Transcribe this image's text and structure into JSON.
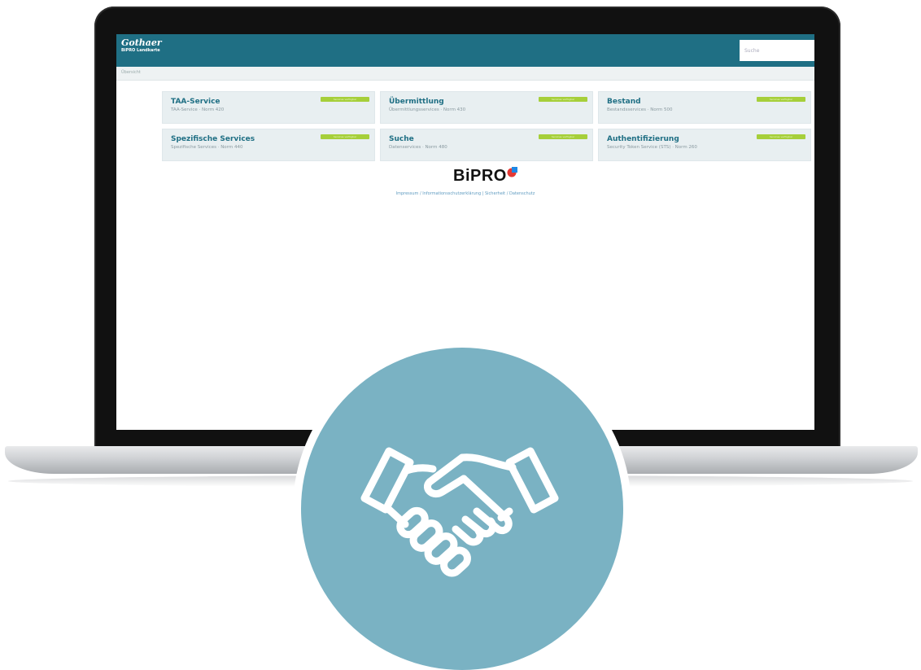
{
  "app": {
    "logo_title": "Gothaer",
    "logo_subtitle": "BiPRO Landkarte",
    "search_placeholder": "Suche",
    "breadcrumb": "Übersicht"
  },
  "cards": [
    {
      "title": "TAA-Service",
      "subtitle": "TAA-Service · Norm 420",
      "badge": "Services verfügbar"
    },
    {
      "title": "Übermittlung",
      "subtitle": "Übermittlungsservices · Norm 430",
      "badge": "Services verfügbar"
    },
    {
      "title": "Bestand",
      "subtitle": "Bestandsservices · Norm 500",
      "badge": "Services verfügbar"
    },
    {
      "title": "Spezifische Services",
      "subtitle": "Spezifische Services · Norm 440",
      "badge": "Services verfügbar"
    },
    {
      "title": "Suche",
      "subtitle": "Datenservices · Norm 480",
      "badge": "Services verfügbar"
    },
    {
      "title": "Authentifizierung",
      "subtitle": "Security Token Service (STS) · Norm 260",
      "badge": "Services verfügbar"
    }
  ],
  "brand": {
    "bipro_logo": "BiPRO"
  },
  "footer": {
    "links": "Impressum / Informationsschutzerklärung | Sicherheit / Datenschutz"
  },
  "colors": {
    "header": "#1f6f84",
    "badge": "#a6cf3a",
    "circle": "#7ab2c3"
  },
  "icons": {
    "overlay": "handshake-icon"
  }
}
